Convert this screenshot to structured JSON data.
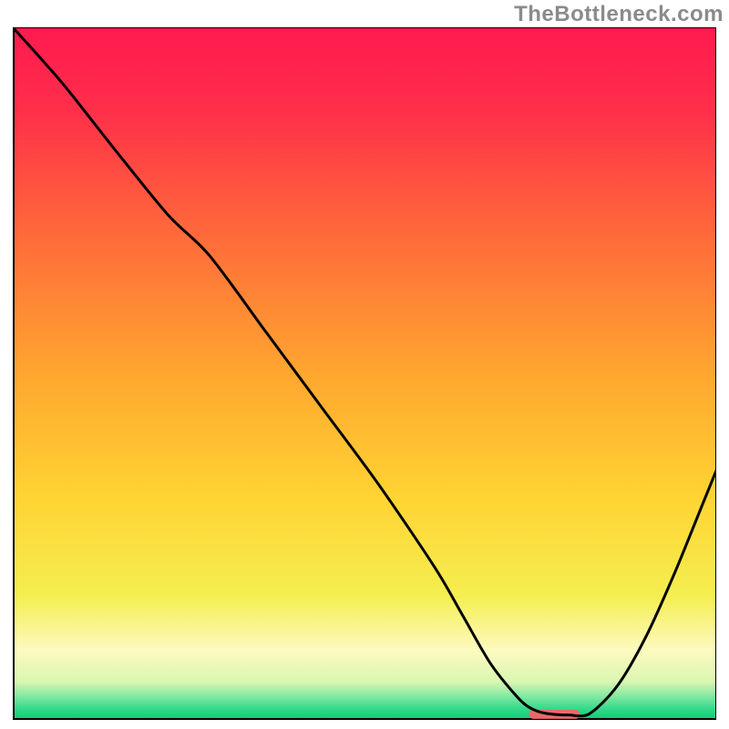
{
  "watermark": "TheBottleneck.com",
  "chart_data": {
    "type": "line",
    "title": "",
    "xlabel": "",
    "ylabel": "",
    "xlim": [
      0,
      100
    ],
    "ylim": [
      0,
      100
    ],
    "grid": false,
    "legend": false,
    "gradient": {
      "stops": [
        {
          "offset": 0.0,
          "color": "#ff1a4f"
        },
        {
          "offset": 0.12,
          "color": "#ff2f4a"
        },
        {
          "offset": 0.3,
          "color": "#ff6a3a"
        },
        {
          "offset": 0.5,
          "color": "#ffa62f"
        },
        {
          "offset": 0.68,
          "color": "#ffd433"
        },
        {
          "offset": 0.82,
          "color": "#f4ee4f"
        },
        {
          "offset": 0.9,
          "color": "#fdfac0"
        },
        {
          "offset": 0.945,
          "color": "#d9f7b0"
        },
        {
          "offset": 0.965,
          "color": "#86e9a2"
        },
        {
          "offset": 0.985,
          "color": "#2fd98a"
        },
        {
          "offset": 1.0,
          "color": "#13c973"
        }
      ]
    },
    "series": [
      {
        "name": "bottleneck-curve",
        "x": [
          0,
          7,
          14,
          22,
          28,
          36,
          44,
          52,
          60,
          64,
          68,
          72,
          74,
          76,
          79,
          82,
          86,
          90,
          94,
          98,
          100
        ],
        "y": [
          100,
          92,
          83,
          73,
          67,
          56,
          45,
          34,
          22,
          15,
          8,
          3,
          1.5,
          0.9,
          0.7,
          0.9,
          5,
          12,
          21,
          31,
          36
        ]
      }
    ],
    "annotations": [
      {
        "name": "optimal-marker",
        "type": "segment",
        "x0": 74,
        "y0": 0.8,
        "x1": 80,
        "y1": 0.8,
        "color": "#e86a6a",
        "width": 10
      }
    ],
    "axes": {
      "color": "#000000",
      "width": 2
    },
    "frame": {
      "top": true,
      "right": true,
      "color": "#000000",
      "width": 1
    }
  }
}
